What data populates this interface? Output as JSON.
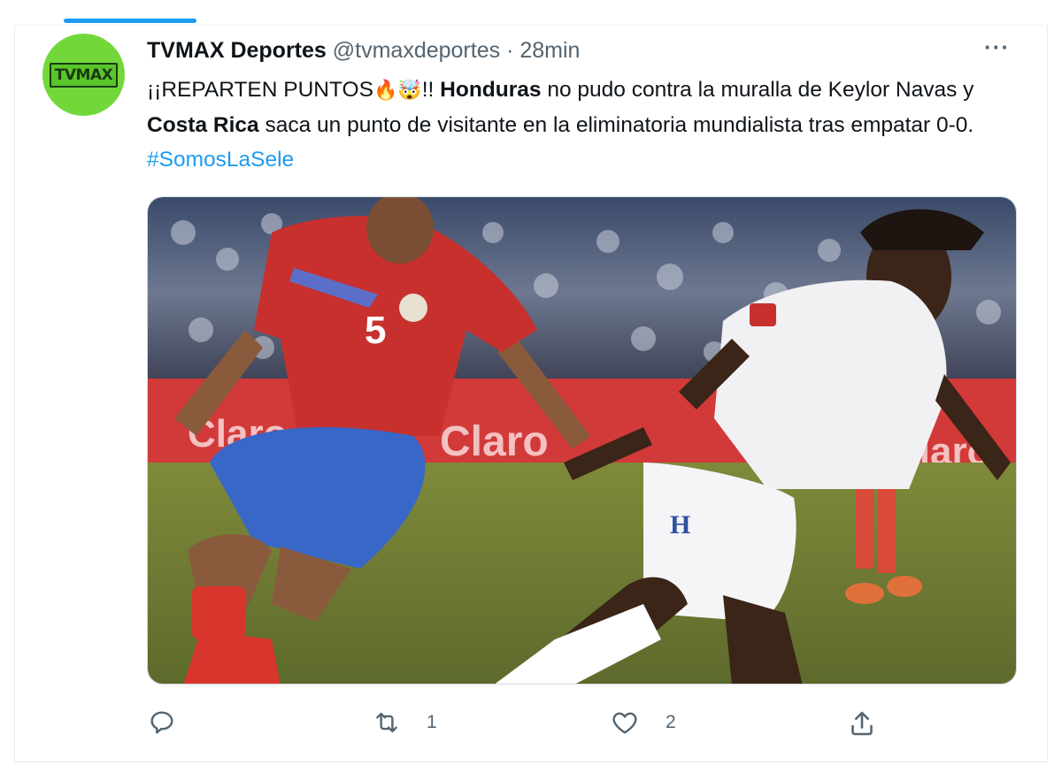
{
  "tweet": {
    "author_name": "TVMAX Deportes",
    "handle": "@tvmaxdeportes",
    "separator": "·",
    "time": "28min",
    "more_label": "···",
    "avatar_logo_text": "TVMAX",
    "text": {
      "part1": "¡¡REPARTEN PUNTOS",
      "emoji1": "🔥",
      "emoji2": "🤯",
      "part2": "!! ",
      "bold1": "Honduras",
      "part3": " no pudo contra la muralla de Keylor Navas y ",
      "bold2": "Costa Rica",
      "part4": " saca un punto de visitante en la eliminatoria mundialista tras empatar 0-0. ",
      "hashtag": "#SomosLaSele"
    },
    "media": {
      "jersey_number": "5",
      "ad_text": "Claro",
      "shorts_letter": "H"
    },
    "actions": {
      "reply_count": "",
      "retweet_count": "1",
      "like_count": "2",
      "share_count": ""
    }
  },
  "colors": {
    "accent": "#1d9bf0",
    "avatar_bg": "#72d83a",
    "text": "#0f1419",
    "muted": "#536471"
  },
  "icons": [
    "more-icon",
    "reply-icon",
    "retweet-icon",
    "like-icon",
    "share-icon"
  ]
}
